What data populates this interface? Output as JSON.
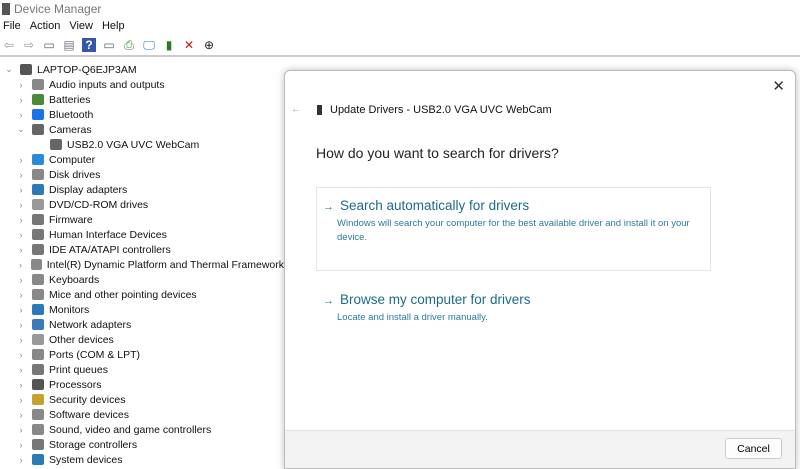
{
  "window": {
    "title": "Device Manager"
  },
  "menu": [
    "File",
    "Action",
    "View",
    "Help"
  ],
  "toolbar": [
    {
      "icon": "back-arrow-icon",
      "glyph": "⇦",
      "color": "#999"
    },
    {
      "icon": "forward-arrow-icon",
      "glyph": "⇨",
      "color": "#999"
    },
    {
      "icon": "show-hide-console-tree-icon",
      "glyph": "▭",
      "color": "#667"
    },
    {
      "icon": "properties-icon",
      "glyph": "▤",
      "color": "#778"
    },
    {
      "icon": "help-icon",
      "glyph": "?",
      "color": "#fff",
      "bg": "#3457a8"
    },
    {
      "icon": "action-pane-icon",
      "glyph": "▭",
      "color": "#667"
    },
    {
      "icon": "update-driver-icon",
      "glyph": "⎙",
      "color": "#3a8a3a"
    },
    {
      "icon": "scan-hardware-icon",
      "glyph": "🖵",
      "color": "#2a7bc0"
    },
    {
      "icon": "enable-device-icon",
      "glyph": "▮",
      "color": "#2a7a2a"
    },
    {
      "icon": "uninstall-device-icon",
      "glyph": "✕",
      "color": "#d01010"
    },
    {
      "icon": "disable-device-icon",
      "glyph": "⊕",
      "color": "#222"
    }
  ],
  "tree": {
    "root": "LAPTOP-Q6EJP3AM",
    "items": [
      {
        "label": "Audio inputs and outputs",
        "color": "#888",
        "expanded": false
      },
      {
        "label": "Batteries",
        "color": "#4a8a3a",
        "expanded": false
      },
      {
        "label": "Bluetooth",
        "color": "#1a73e8",
        "expanded": false
      },
      {
        "label": "Cameras",
        "color": "#666",
        "expanded": true
      },
      {
        "label": "USB2.0 VGA UVC WebCam",
        "color": "#666",
        "child": true
      },
      {
        "label": "Computer",
        "color": "#2a8ad8",
        "expanded": false
      },
      {
        "label": "Disk drives",
        "color": "#888",
        "expanded": false
      },
      {
        "label": "Display adapters",
        "color": "#2a7ab8",
        "expanded": false
      },
      {
        "label": "DVD/CD-ROM drives",
        "color": "#999",
        "expanded": false
      },
      {
        "label": "Firmware",
        "color": "#777",
        "expanded": false
      },
      {
        "label": "Human Interface Devices",
        "color": "#777",
        "expanded": false
      },
      {
        "label": "IDE ATA/ATAPI controllers",
        "color": "#777",
        "expanded": false
      },
      {
        "label": "Intel(R) Dynamic Platform and Thermal Framework",
        "color": "#888",
        "expanded": false
      },
      {
        "label": "Keyboards",
        "color": "#888",
        "expanded": false
      },
      {
        "label": "Mice and other pointing devices",
        "color": "#888",
        "expanded": false
      },
      {
        "label": "Monitors",
        "color": "#2a7ab8",
        "expanded": false
      },
      {
        "label": "Network adapters",
        "color": "#3a7ab8",
        "expanded": false
      },
      {
        "label": "Other devices",
        "color": "#999",
        "expanded": false
      },
      {
        "label": "Ports (COM & LPT)",
        "color": "#888",
        "expanded": false
      },
      {
        "label": "Print queues",
        "color": "#777",
        "expanded": false
      },
      {
        "label": "Processors",
        "color": "#555",
        "expanded": false
      },
      {
        "label": "Security devices",
        "color": "#c8a030",
        "expanded": false
      },
      {
        "label": "Software devices",
        "color": "#888",
        "expanded": false
      },
      {
        "label": "Sound, video and game controllers",
        "color": "#888",
        "expanded": false
      },
      {
        "label": "Storage controllers",
        "color": "#777",
        "expanded": false
      },
      {
        "label": "System devices",
        "color": "#2a7ab8",
        "expanded": false
      }
    ]
  },
  "dialog": {
    "title": "Update Drivers - USB2.0 VGA UVC WebCam",
    "question": "How do you want to search for drivers?",
    "options": [
      {
        "heading": "Search automatically for drivers",
        "description": "Windows will search your computer for the best available driver and install it on your device."
      },
      {
        "heading": "Browse my computer for drivers",
        "description": "Locate and install a driver manually."
      }
    ],
    "arrow": "→",
    "back": "←",
    "close": "✕",
    "cancel_label": "Cancel"
  },
  "colors": {
    "link": "#1e6a8a"
  }
}
